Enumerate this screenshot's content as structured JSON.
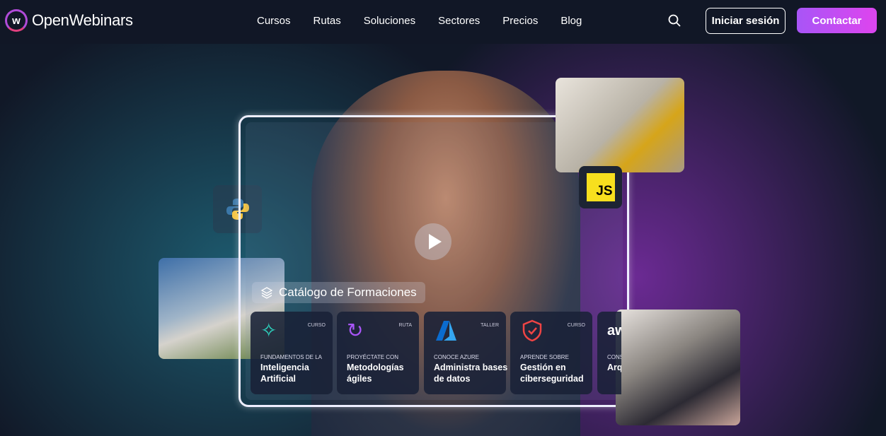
{
  "brand": {
    "name": "OpenWebinars",
    "logo_letter": "w"
  },
  "nav": {
    "items": [
      "Cursos",
      "Rutas",
      "Soluciones",
      "Sectores",
      "Precios",
      "Blog"
    ],
    "login": "Iniciar sesión",
    "contact": "Contactar"
  },
  "hero": {
    "catalog_label": "Catálogo de Formaciones",
    "badges": {
      "js": "JS"
    },
    "cards": [
      {
        "tag": "CURSO",
        "subtitle": "FUNDAMENTOS DE LA",
        "title": "Inteligencia Artificial",
        "icon": "sparkle-icon",
        "color": "#2dd4bf"
      },
      {
        "tag": "RUTA",
        "subtitle": "PROYÉCTATE CON",
        "title": "Metodologías ágiles",
        "icon": "agile-cycle-icon",
        "color": "#a855f7"
      },
      {
        "tag": "TALLER",
        "subtitle": "CONOCE AZURE",
        "title": "Administra bases de datos",
        "icon": "azure-icon",
        "color": "#1e88e5"
      },
      {
        "tag": "CURSO",
        "subtitle": "APRENDE SOBRE",
        "title": "Gestión en ciberseguridad",
        "icon": "shield-check-icon",
        "color": "#ef4444"
      },
      {
        "tag": "",
        "subtitle": "CONS",
        "title": "Arq con",
        "icon": "aws-icon",
        "color": "#ff9900"
      }
    ]
  }
}
